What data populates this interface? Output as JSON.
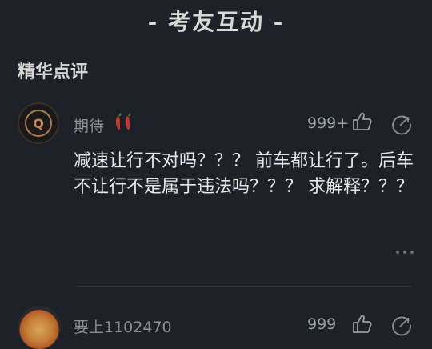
{
  "header": {
    "title": "- 考友互动 -"
  },
  "section": {
    "title": "精华点评"
  },
  "comments": [
    {
      "avatar_letter": "Q",
      "username": "期待",
      "badge_icon": "chili-pepper-icon",
      "likes": "999+",
      "text": "减速让行不对吗？？？ 前车都让行了。后车不让行不是属于违法吗？？？ 求解释？？？"
    },
    {
      "username": "要上1102470",
      "likes": "999"
    }
  ],
  "colors": {
    "background": "#1e2127",
    "avatar_ring": "#b27a4a",
    "text_primary": "#e8e8e8",
    "text_secondary": "#8b8f96"
  }
}
